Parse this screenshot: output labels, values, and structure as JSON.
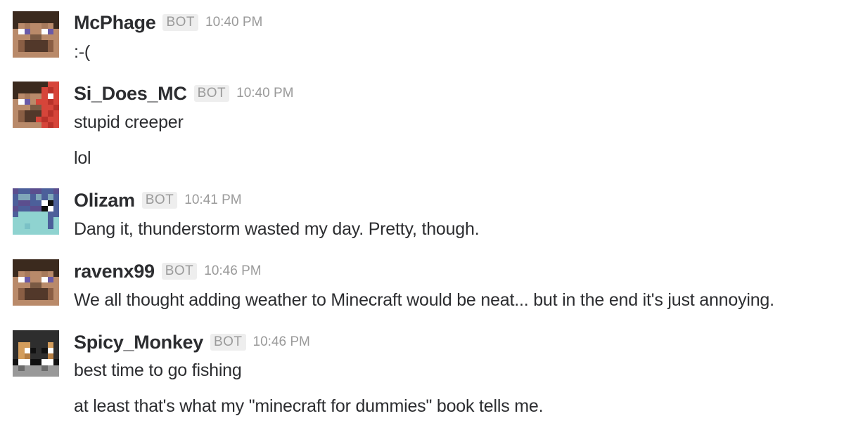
{
  "messages": [
    {
      "author": "McPhage",
      "badge": "BOT",
      "time": "10:40 PM",
      "avatar_icon": "minecraft-steve-skin-icon",
      "lines": [
        ":-("
      ]
    },
    {
      "author": "Si_Does_MC",
      "badge": "BOT",
      "time": "10:40 PM",
      "avatar_icon": "minecraft-red-skin-icon",
      "lines": [
        "stupid creeper",
        "lol"
      ]
    },
    {
      "author": "Olizam",
      "badge": "BOT",
      "time": "10:41 PM",
      "avatar_icon": "minecraft-purple-hair-skin-icon",
      "lines": [
        "Dang it, thunderstorm wasted my day. Pretty, though."
      ]
    },
    {
      "author": "ravenx99",
      "badge": "BOT",
      "time": "10:46 PM",
      "avatar_icon": "minecraft-steve-skin-icon",
      "lines": [
        "We all thought adding weather to Minecraft would be neat... but in the end it's just annoying."
      ]
    },
    {
      "author": "Spicy_Monkey",
      "badge": "BOT",
      "time": "10:46 PM",
      "avatar_icon": "minecraft-monkey-skin-icon",
      "lines": [
        "best time to go fishing",
        "at least that's what my \"minecraft for dummies\" book tells me."
      ]
    }
  ],
  "colors": {
    "text": "#2c2d30",
    "meta": "#9a9a9a",
    "badge_bg": "#eeeeee"
  }
}
